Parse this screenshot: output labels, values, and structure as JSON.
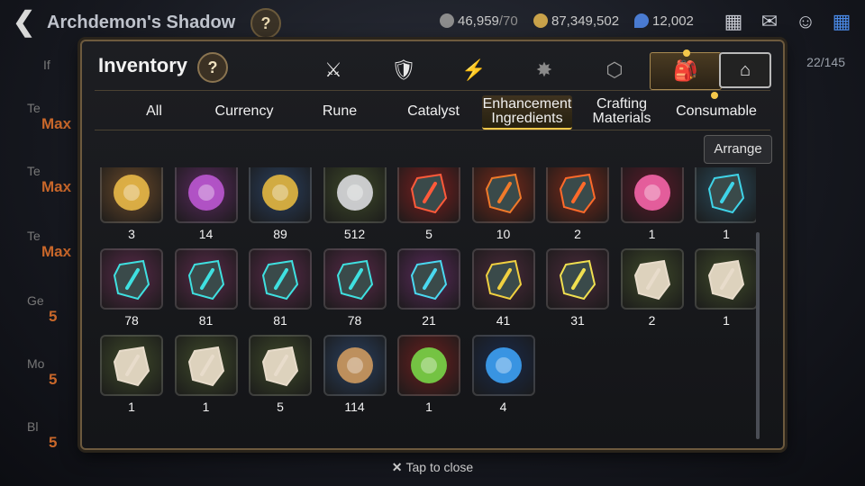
{
  "hud": {
    "back_glyph": "❮",
    "stage_title": "Archdemon's Shadow",
    "help_glyph": "?",
    "stamina": {
      "value": "46,959",
      "max": "/70",
      "color": "#8c8c8c"
    },
    "gold": {
      "value": "87,349,502",
      "color": "#c9a24a"
    },
    "skystone": {
      "value": "12,002",
      "color": "#4a7bd1"
    },
    "icons": [
      "shop-icon",
      "mail-icon",
      "chat-icon",
      "menu-grid-icon"
    ]
  },
  "background": {
    "rows": [
      {
        "label": "Te",
        "value": "Max"
      },
      {
        "label": "Te",
        "value": "Max"
      },
      {
        "label": "Te",
        "value": "Max"
      },
      {
        "label": "Ge",
        "value": "5"
      },
      {
        "label": "Mo",
        "value": "5"
      },
      {
        "label": "Bl",
        "value": "5"
      }
    ],
    "counter": "22/145",
    "partial_label": "If"
  },
  "modal": {
    "title": "Inventory",
    "help": "?",
    "category_tabs": [
      {
        "name": "equipment",
        "glyph": "⚔",
        "selected": false
      },
      {
        "name": "artifact",
        "glyph": "🛡",
        "selected": false
      },
      {
        "name": "catalyst",
        "glyph": "⚡",
        "selected": false
      },
      {
        "name": "special",
        "glyph": "✸",
        "selected": false
      },
      {
        "name": "box",
        "glyph": "⬡",
        "selected": false
      },
      {
        "name": "materials",
        "glyph": "🎒",
        "selected": true
      }
    ],
    "storage_glyph": "⌂",
    "filters": [
      {
        "label": "All",
        "selected": false
      },
      {
        "label": "Currency",
        "selected": false
      },
      {
        "label": "Rune",
        "selected": false
      },
      {
        "label": "Catalyst",
        "selected": false
      },
      {
        "label": "Enhancement Ingredients",
        "selected": true
      },
      {
        "label": "Crafting Materials",
        "selected": false
      },
      {
        "label": "Consumable",
        "selected": false
      }
    ],
    "arrange_label": "Arrange",
    "items": [
      {
        "count": "3",
        "bg": "#6b4a2a",
        "icon": "phantasma",
        "color": "#f2c14a"
      },
      {
        "count": "14",
        "bg": "#5a2a5e",
        "icon": "purple-flower",
        "color": "#c35adb"
      },
      {
        "count": "89",
        "bg": "#2a3f5e",
        "icon": "gold-flower",
        "color": "#f0c040"
      },
      {
        "count": "512",
        "bg": "#3f4a2a",
        "icon": "silver-flower",
        "color": "#e4e4ea"
      },
      {
        "count": "5",
        "bg": "#7a1f1f",
        "icon": "red-rune-hex",
        "color": "#ff5a3a"
      },
      {
        "count": "10",
        "bg": "#7a2a1a",
        "icon": "red-rune",
        "color": "#f07a2a"
      },
      {
        "count": "2",
        "bg": "#7a2a1a",
        "icon": "red-rune-small",
        "color": "#ff6a2a"
      },
      {
        "count": "1",
        "bg": "#5a1a2a",
        "icon": "pink-potion",
        "color": "#ff6ab0"
      },
      {
        "count": "1",
        "bg": "#2a4a5a",
        "icon": "blue-rune-stone",
        "color": "#3fd4e8"
      },
      {
        "count": "78",
        "bg": "#5a2a4a",
        "icon": "teal-rune",
        "color": "#3fe0e0"
      },
      {
        "count": "81",
        "bg": "#5a2a4a",
        "icon": "teal-rune-spiral",
        "color": "#3fe0e0"
      },
      {
        "count": "81",
        "bg": "#5a2a4a",
        "icon": "teal-rune-bolt",
        "color": "#3fe0e0"
      },
      {
        "count": "78",
        "bg": "#5a2a4a",
        "icon": "teal-rune-boot",
        "color": "#3fe0e0"
      },
      {
        "count": "21",
        "bg": "#5a2a5a",
        "icon": "teal-rune-hex",
        "color": "#4ad8f0"
      },
      {
        "count": "41",
        "bg": "#4a2a3a",
        "icon": "gold-rune-hammer",
        "color": "#f0d040"
      },
      {
        "count": "31",
        "bg": "#4a2a3a",
        "icon": "gold-rune-slash",
        "color": "#f0e050"
      },
      {
        "count": "2",
        "bg": "#3f4a2a",
        "icon": "stone-rune",
        "color": "#e8dccb"
      },
      {
        "count": "1",
        "bg": "#3f4a2a",
        "icon": "stone-rune-swirl",
        "color": "#e8dccb"
      },
      {
        "count": "1",
        "bg": "#3f4a2a",
        "icon": "stone-rune-glyph",
        "color": "#e8dccb"
      },
      {
        "count": "1",
        "bg": "#3f4a2a",
        "icon": "stone-rune-boot",
        "color": "#e8dccb"
      },
      {
        "count": "5",
        "bg": "#3f4a2a",
        "icon": "stone-rune-hex",
        "color": "#e8dccb"
      },
      {
        "count": "114",
        "bg": "#2a3f5e",
        "icon": "leaf-branch",
        "color": "#d8a060"
      },
      {
        "count": "1",
        "bg": "#6b1f1f",
        "icon": "green-orb",
        "color": "#7ae04a"
      },
      {
        "count": "4",
        "bg": "#1a2a4a",
        "icon": "blue-sigil",
        "color": "#3fa8ff"
      }
    ]
  },
  "footer": {
    "close_glyph": "✕",
    "label": "Tap to close"
  }
}
